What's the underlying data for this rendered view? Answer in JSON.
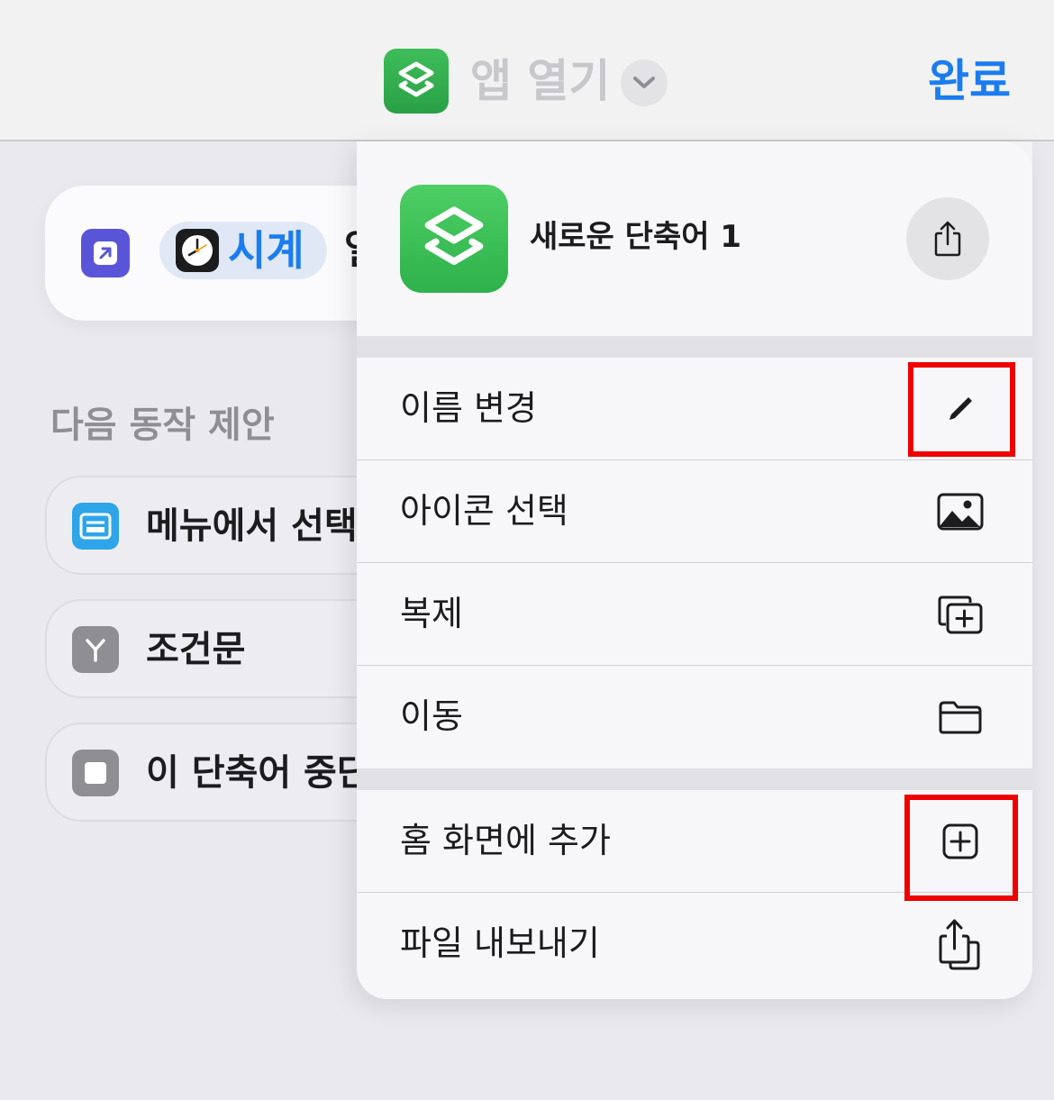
{
  "header": {
    "title": "앱 열기",
    "done_label": "완료"
  },
  "editor": {
    "action": {
      "app_label": "시계",
      "tail_text": "열"
    },
    "suggestions_title": "다음 동작 제안",
    "suggestions": [
      {
        "label": "메뉴에서 선택",
        "icon": "menu-list-icon",
        "color": "#2da5e8"
      },
      {
        "label": "조건문",
        "icon": "branch-icon",
        "color": "#8e8e93"
      },
      {
        "label": "이 단축어 중단",
        "icon": "stop-icon",
        "color": "#8e8e93"
      }
    ]
  },
  "menu": {
    "shortcut_name": "새로운 단축어 1",
    "items": [
      {
        "label": "이름 변경",
        "icon": "pencil-icon"
      },
      {
        "label": "아이콘 선택",
        "icon": "photo-icon"
      },
      {
        "label": "복제",
        "icon": "duplicate-icon"
      },
      {
        "label": "이동",
        "icon": "folder-icon"
      },
      {
        "label": "홈 화면에 추가",
        "icon": "plus-square-icon"
      },
      {
        "label": "파일 내보내기",
        "icon": "export-icon"
      }
    ]
  },
  "colors": {
    "accent": "#1b7cf0",
    "shortcuts_green": "#34c759",
    "highlight_red": "#ee0000"
  }
}
